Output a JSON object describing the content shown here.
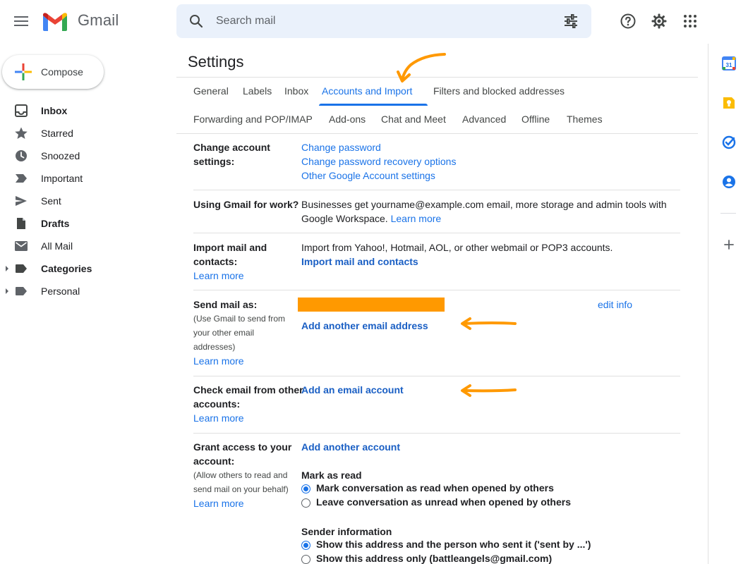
{
  "header": {
    "app_name": "Gmail",
    "search_placeholder": "Search mail"
  },
  "compose": {
    "label": "Compose"
  },
  "sidebar": {
    "items": [
      {
        "label": "Inbox",
        "icon": "inbox-icon",
        "bold": true
      },
      {
        "label": "Starred",
        "icon": "star-icon"
      },
      {
        "label": "Snoozed",
        "icon": "clock-icon"
      },
      {
        "label": "Important",
        "icon": "important-icon"
      },
      {
        "label": "Sent",
        "icon": "send-icon"
      },
      {
        "label": "Drafts",
        "icon": "draft-icon",
        "bold": true
      },
      {
        "label": "All Mail",
        "icon": "mail-icon"
      },
      {
        "label": "Categories",
        "icon": "label-icon",
        "bold": true
      },
      {
        "label": "Personal",
        "icon": "label-icon"
      }
    ]
  },
  "settings": {
    "title": "Settings",
    "tabs_row1": [
      "General",
      "Labels",
      "Inbox",
      "Accounts and Import",
      "Filters and blocked addresses"
    ],
    "tabs_row2": [
      "Forwarding and POP/IMAP",
      "Add-ons",
      "Chat and Meet",
      "Advanced",
      "Offline",
      "Themes"
    ],
    "active_tab": "Accounts and Import",
    "change_account": {
      "label_line1": "Change account",
      "label_line2": "settings:",
      "links": [
        "Change password",
        "Change password recovery options",
        "Other Google Account settings"
      ]
    },
    "gmail_for_work": {
      "label": "Using Gmail for work?",
      "text_line1": "Businesses get yourname@example.com email, more storage and admin tools with",
      "text_line2": "Google Workspace.",
      "learn_more": "Learn more"
    },
    "import_mail": {
      "label_line1": "Import mail and",
      "label_line2": "contacts:",
      "learn_more": "Learn more",
      "text": "Import from Yahoo!, Hotmail, AOL, or other webmail or POP3 accounts.",
      "action": "Import mail and contacts"
    },
    "send_mail_as": {
      "label": "Send mail as:",
      "sub_line1": "(Use Gmail to send from",
      "sub_line2": "your other email",
      "sub_line3": "addresses)",
      "learn_more": "Learn more",
      "edit_info": "edit info",
      "action": "Add another email address"
    },
    "check_email": {
      "label_line1": "Check email from other",
      "label_line2": "accounts:",
      "learn_more": "Learn more",
      "action": "Add an email account"
    },
    "grant_access": {
      "label_line1": "Grant access to your",
      "label_line2": "account:",
      "sub_line1": "(Allow others to read and",
      "sub_line2": "send mail on your behalf)",
      "learn_more": "Learn more",
      "action": "Add another account",
      "mark_as_read_heading": "Mark as read",
      "mark_read_options": [
        "Mark conversation as read when opened by others",
        "Leave conversation as unread when opened by others"
      ],
      "mark_read_selected": 0,
      "sender_info_heading": "Sender information",
      "sender_options": [
        "Show this address and the person who sent it ('sent by ...')",
        "Show this address only (battleangels@gmail.com)"
      ],
      "sender_selected": 0
    }
  },
  "right_rail": {
    "calendar_date": "31",
    "icons": [
      "calendar-icon",
      "keep-icon",
      "tasks-icon",
      "contacts-icon",
      "add-icon"
    ]
  },
  "colors": {
    "accent": "#1a73e8",
    "annotation": "#ff9900",
    "search_bg": "#eaf1fb"
  }
}
